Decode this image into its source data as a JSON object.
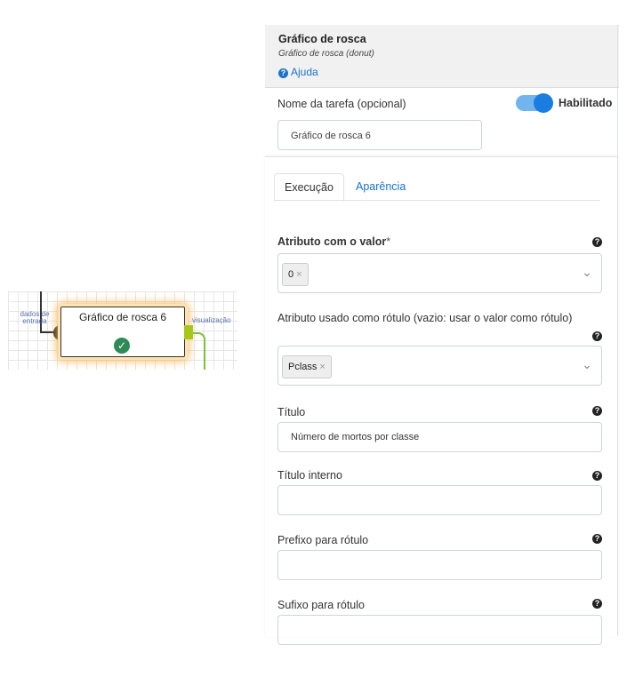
{
  "canvas": {
    "node_title": "Gráfico de rosca 6",
    "port_in_label": "dados de entrada",
    "port_out_label": "visualização",
    "status_icon": "check-circle-icon"
  },
  "panel": {
    "title": "Gráfico de rosca",
    "subtitle": "Gráfico de rosca (donut)",
    "help_label": "Ajuda",
    "task_name_label": "Nome da tarefa (opcional)",
    "task_name_value": "Gráfico de rosca 6",
    "enabled_label": "Habilitado",
    "enabled": true,
    "tabs": [
      {
        "label": "Execução",
        "active": true
      },
      {
        "label": "Aparência",
        "active": false
      }
    ],
    "fields": {
      "value_attr": {
        "label": "Atributo com o valor",
        "required_mark": "*",
        "chip": "0",
        "chip_remove": "×"
      },
      "label_attr": {
        "label": "Atributo usado como rótulo (vazio: usar o valor como rótulo)",
        "chip": "Pclass",
        "chip_remove": "×"
      },
      "title": {
        "label": "Título",
        "value": "Número de mortos por classe"
      },
      "inner_title": {
        "label": "Título interno",
        "value": ""
      },
      "label_prefix": {
        "label": "Prefixo para rótulo",
        "value": ""
      },
      "label_suffix": {
        "label": "Sufixo para rótulo",
        "value": ""
      }
    }
  },
  "colors": {
    "accent": "#1a73c8",
    "toggle_on": "#1a7de0",
    "success": "#2e8b57",
    "node_glow": "#f7b85c",
    "output_port": "#a8c61a"
  }
}
